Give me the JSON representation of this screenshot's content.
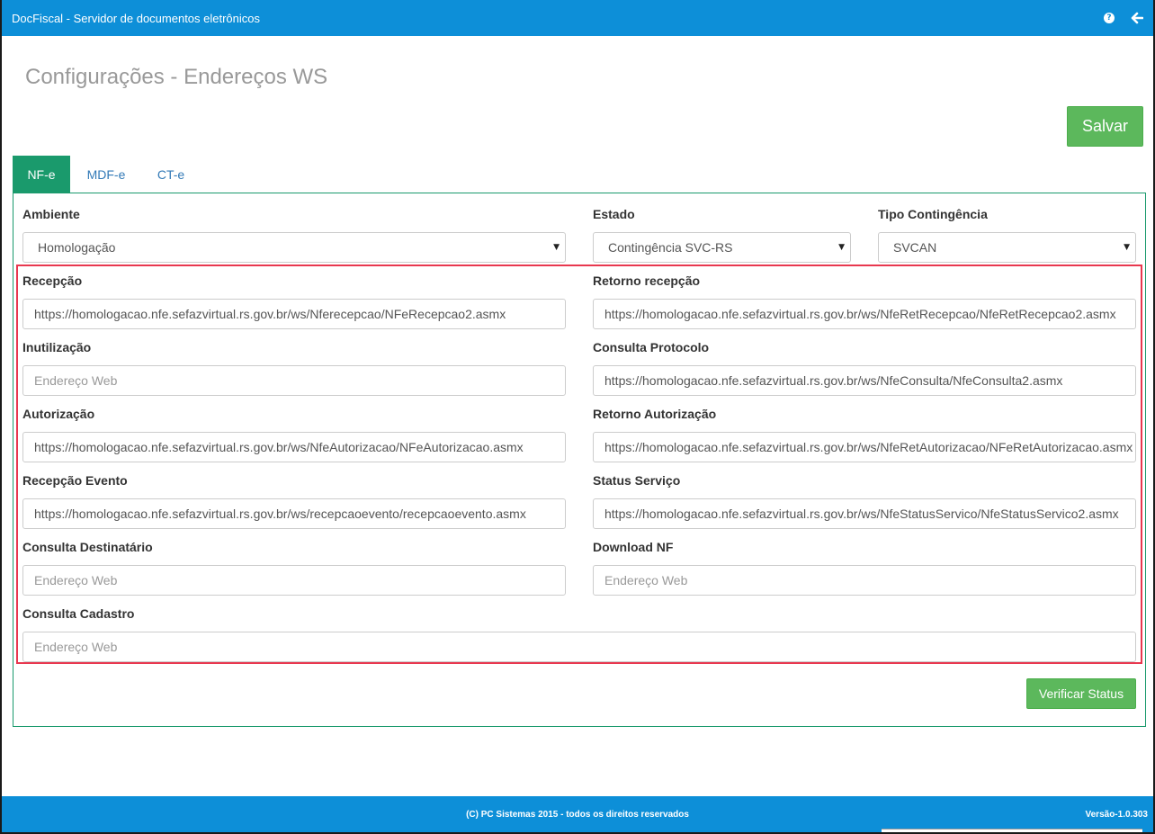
{
  "header": {
    "app_title": "DocFiscal - Servidor de documentos eletrônicos",
    "help_icon": "?",
    "icons": [
      "help-icon",
      "back-arrow-icon"
    ]
  },
  "page": {
    "title": "Configurações - Endereços WS",
    "save_label": "Salvar"
  },
  "tabs": [
    {
      "label": "NF-e",
      "active": true
    },
    {
      "label": "MDF-e",
      "active": false
    },
    {
      "label": "CT-e",
      "active": false
    }
  ],
  "selects": {
    "ambiente": {
      "label": "Ambiente",
      "value": "Homologação"
    },
    "estado": {
      "label": "Estado",
      "value": "Contingência SVC-RS"
    },
    "tipo_contingencia": {
      "label": "Tipo Contingência",
      "value": "SVCAN"
    }
  },
  "fields": {
    "recepcao": {
      "label": "Recepção",
      "value": "https://homologacao.nfe.sefazvirtual.rs.gov.br/ws/Nferecepcao/NFeRecepcao2.asmx"
    },
    "retorno_recepcao": {
      "label": "Retorno recepção",
      "value": "https://homologacao.nfe.sefazvirtual.rs.gov.br/ws/NfeRetRecepcao/NfeRetRecepcao2.asmx"
    },
    "inutilizacao": {
      "label": "Inutilização",
      "placeholder": "Endereço Web"
    },
    "consulta_protocolo": {
      "label": "Consulta Protocolo",
      "value": "https://homologacao.nfe.sefazvirtual.rs.gov.br/ws/NfeConsulta/NfeConsulta2.asmx"
    },
    "autorizacao": {
      "label": "Autorização",
      "value": "https://homologacao.nfe.sefazvirtual.rs.gov.br/ws/NfeAutorizacao/NFeAutorizacao.asmx"
    },
    "retorno_autorizacao": {
      "label": "Retorno Autorização",
      "value": "https://homologacao.nfe.sefazvirtual.rs.gov.br/ws/NfeRetAutorizacao/NFeRetAutorizacao.asmx"
    },
    "recepcao_evento": {
      "label": "Recepção Evento",
      "value": "https://homologacao.nfe.sefazvirtual.rs.gov.br/ws/recepcaoevento/recepcaoevento.asmx"
    },
    "status_servico": {
      "label": "Status Serviço",
      "value": "https://homologacao.nfe.sefazvirtual.rs.gov.br/ws/NfeStatusServico/NfeStatusServico2.asmx"
    },
    "consulta_destinatario": {
      "label": "Consulta Destinatário",
      "placeholder": "Endereço Web"
    },
    "download_nf": {
      "label": "Download NF",
      "placeholder": "Endereço Web"
    },
    "consulta_cadastro": {
      "label": "Consulta Cadastro",
      "placeholder": "Endereço Web"
    }
  },
  "actions": {
    "verificar_status_label": "Verificar Status"
  },
  "footer": {
    "copyright": "(C) PC Sistemas 2015 - todos os direitos reservados",
    "version": "Versão-1.0.303"
  },
  "colors": {
    "header_blue": "#0d8fd8",
    "tab_active_green": "#1a9a6c",
    "button_green": "#5cb85c",
    "highlight_red": "#e8384f"
  }
}
